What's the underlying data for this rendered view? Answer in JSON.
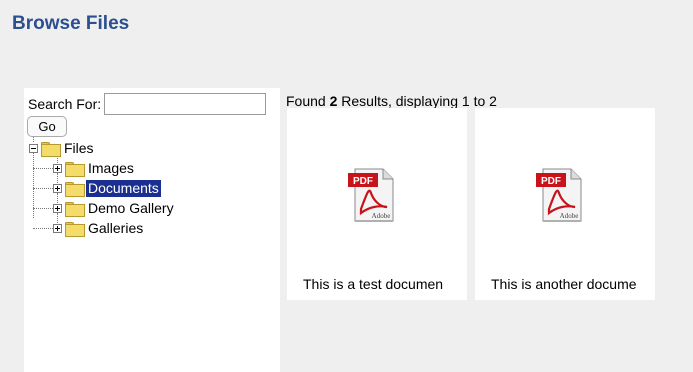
{
  "page": {
    "title": "Browse Files"
  },
  "search": {
    "label": "Search For:",
    "value": "",
    "placeholder": "",
    "go_label": "Go"
  },
  "tree": {
    "root": "Files",
    "children": [
      "Images",
      "Documents",
      "Demo Gallery",
      "Galleries"
    ],
    "selected": "Documents"
  },
  "results": {
    "found_prefix": "Found ",
    "count": "2",
    "found_suffix": " Results, displaying 1 to 2",
    "items": [
      {
        "caption": "This is a test documen",
        "icon": "pdf-icon",
        "icon_badge": "PDF",
        "icon_brand": "Adobe"
      },
      {
        "caption": "This is another docume",
        "icon": "pdf-icon",
        "icon_badge": "PDF",
        "icon_brand": "Adobe"
      }
    ]
  },
  "colors": {
    "title": "#2b4f8f",
    "selection": "#1a2f8f",
    "pdf_red": "#c8131b",
    "folder": "#f3dc6a"
  }
}
